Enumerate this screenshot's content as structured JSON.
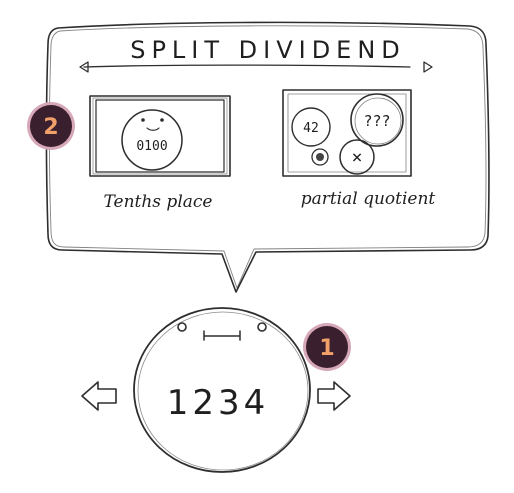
{
  "bubble": {
    "title": "SPLIT DIVIDEND",
    "options": [
      {
        "label": "Tenths place",
        "inner_number": "0100"
      },
      {
        "label": "partial quotient",
        "unknown_text": "???",
        "small_number": "42",
        "cross_mark": "×"
      }
    ]
  },
  "character": {
    "number": "1234"
  },
  "badges": [
    {
      "number": "1"
    },
    {
      "number": "2"
    }
  ],
  "colors": {
    "badge_fill": "#3a1f2e",
    "badge_ring": "#d6a8b8",
    "badge_text": "#f2a06a",
    "pencil": "#2e2e2e"
  },
  "icons": {
    "left_arrow": "left-arrow-icon",
    "right_arrow": "right-arrow-icon",
    "prev_triangle": "prev-triangle-icon",
    "next_triangle": "next-triangle-icon"
  }
}
